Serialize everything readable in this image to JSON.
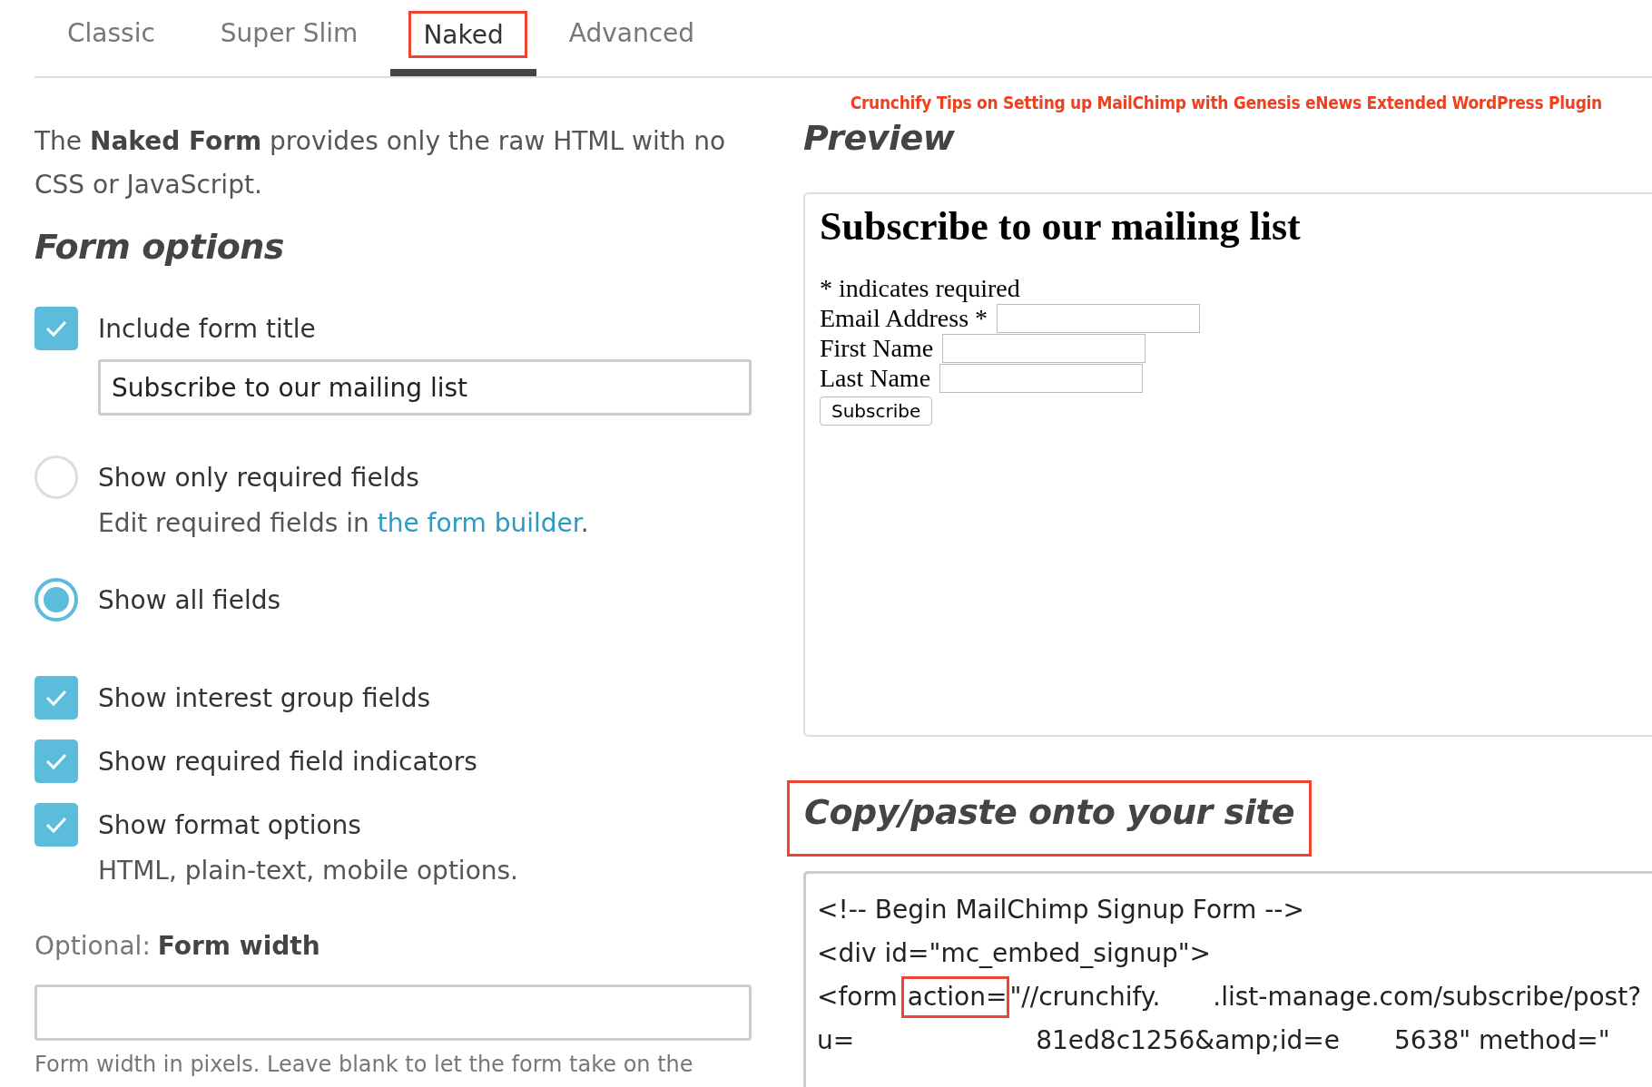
{
  "tabs": [
    {
      "label": "Classic",
      "selected": false,
      "highlighted": false
    },
    {
      "label": "Super Slim",
      "selected": false,
      "highlighted": false
    },
    {
      "label": "Naked",
      "selected": true,
      "highlighted": true
    },
    {
      "label": "Advanced",
      "selected": false,
      "highlighted": false
    }
  ],
  "banner": "Crunchify Tips on Setting up MailChimp with Genesis eNews Extended WordPress Plugin",
  "intro": "The **Naked Form** provides only the raw HTML with no CSS or JavaScript.",
  "form_options": {
    "title": "Form options",
    "options": [
      {
        "kind": "checkbox",
        "label": "Include form title",
        "checked": true,
        "value": "Subscribe to our mailing list"
      },
      {
        "kind": "radio",
        "label": "Show only required fields",
        "selected": false,
        "note": {
          "before": "Edit required fields in ",
          "link": "the form builder",
          "after": "."
        }
      },
      {
        "kind": "radio",
        "label": "Show all fields",
        "selected": true
      },
      {
        "kind": "checkbox",
        "label": "Show interest group fields",
        "checked": true
      },
      {
        "kind": "checkbox",
        "label": "Show required field indicators",
        "checked": true
      },
      {
        "kind": "checkbox",
        "label": "Show format options",
        "checked": true,
        "help": "HTML, plain-text, mobile options."
      }
    ]
  },
  "form_width": {
    "prefix": "Optional:",
    "label": "Form width",
    "help": "Form width in pixels. Leave blank to let the form take on the"
  },
  "preview": {
    "title": "Preview",
    "form_title": "Subscribe to our mailing list",
    "required_note": "* indicates required",
    "fields": [
      {
        "label": "Email Address *"
      },
      {
        "label": "First Name"
      },
      {
        "label": "Last Name"
      }
    ],
    "button": "Subscribe"
  },
  "code": {
    "title": "Copy/paste onto your site",
    "highlighted": true,
    "lines": [
      {
        "segments": [
          {
            "kind": "text",
            "text": "<!-- Begin MailChimp Signup Form -->"
          }
        ]
      },
      {
        "segments": [
          {
            "kind": "text",
            "text": "<div id=\"mc_embed_signup\">"
          }
        ]
      },
      {
        "segments": [
          {
            "kind": "text",
            "text": "<form"
          },
          {
            "kind": "highlight",
            "text": "action="
          },
          {
            "kind": "text",
            "text": "\"//crunchify."
          },
          {
            "kind": "gap"
          },
          {
            "kind": "text",
            "text": ".list-manage.com/subscribe/post?"
          }
        ]
      },
      {
        "segments": [
          {
            "kind": "text",
            "text": "u="
          },
          {
            "kind": "gap"
          },
          {
            "kind": "text",
            "text": "81ed8c1256&amp;id=e"
          },
          {
            "kind": "gap"
          },
          {
            "kind": "text",
            "text": "5638\" method=\""
          }
        ]
      }
    ]
  }
}
